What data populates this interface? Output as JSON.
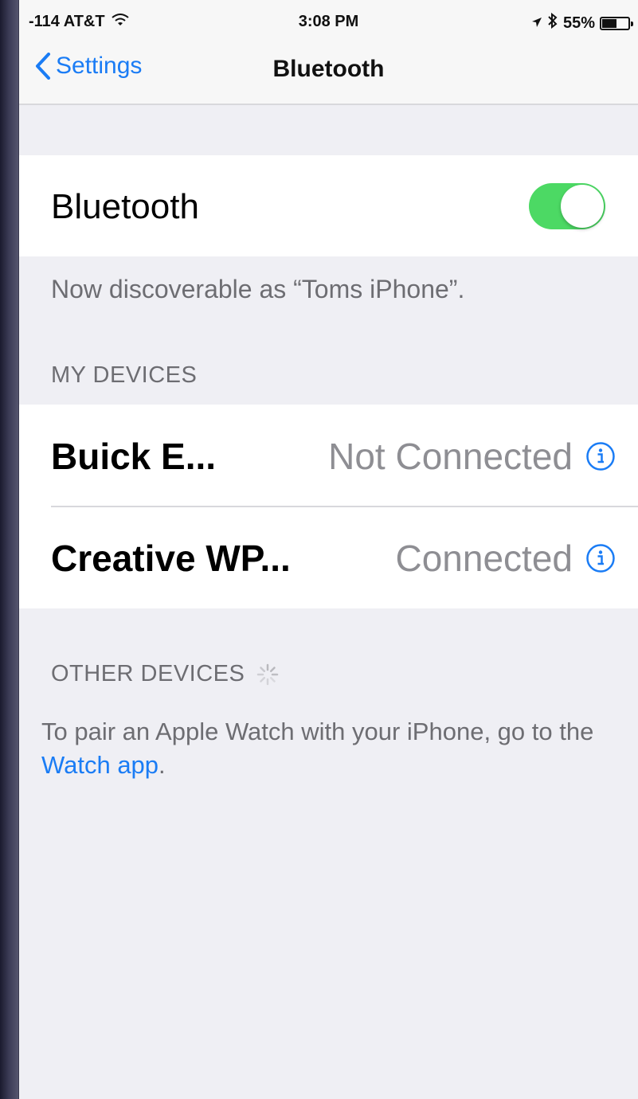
{
  "status_bar": {
    "carrier": "-114 AT&T",
    "time": "3:08 PM",
    "battery_percent": "55%",
    "battery_level": 0.55,
    "icons": [
      "wifi-icon",
      "location-arrow-icon",
      "bluetooth-icon",
      "battery-icon"
    ]
  },
  "nav": {
    "back_label": "Settings",
    "title": "Bluetooth"
  },
  "bluetooth": {
    "label": "Bluetooth",
    "enabled": true,
    "toggle_color": "#4cd964",
    "discoverable_text": "Now discoverable as “Toms iPhone”."
  },
  "my_devices": {
    "header": "MY DEVICES",
    "items": [
      {
        "name": "Buick E...",
        "status": "Not Connected"
      },
      {
        "name": "Creative WP...",
        "status": "Connected"
      }
    ]
  },
  "other_devices": {
    "header": "OTHER DEVICES"
  },
  "pair_note": {
    "text_before": "To pair an Apple Watch with your iPhone, go to the ",
    "link": "Watch app",
    "text_after": "."
  },
  "colors": {
    "accent": "#1a7cf5",
    "background": "#efeff4",
    "secondary_text": "#8e8e93"
  }
}
